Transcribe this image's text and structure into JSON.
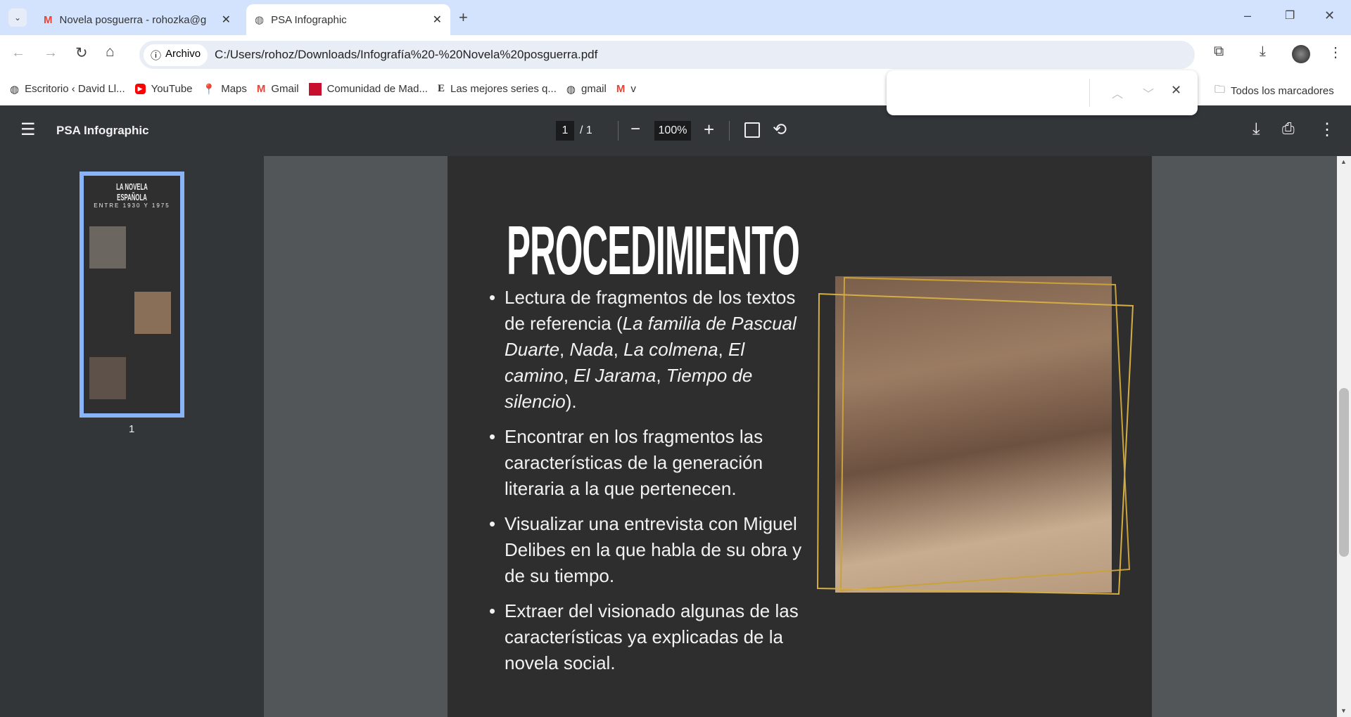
{
  "tabs": [
    {
      "label": "Novela posguerra - rohozka@g",
      "icon": "gmail-icon"
    },
    {
      "label": "PSA Infographic",
      "icon": "globe-icon"
    }
  ],
  "address": {
    "chip": "Archivo",
    "url": "C:/Users/rohoz/Downloads/Infografía%20-%20Novela%20posguerra.pdf"
  },
  "bookmarks": [
    "Escritorio ‹ David Ll...",
    "YouTube",
    "Maps",
    "Gmail",
    "Comunidad de Mad...",
    "Las mejores series q...",
    "gmail",
    "v"
  ],
  "all_bookmarks": "Todos los marcadores",
  "pdf": {
    "title": "PSA Infographic",
    "page": "1",
    "total": "/  1",
    "zoom": "100%",
    "thumb_label": "1"
  },
  "content": {
    "heading": "PROCEDIMIENTO",
    "bullet1": [
      {
        "t": "Lectura de fragmentos de los textos de referencia ("
      },
      {
        "t": "La familia de Pascual Duarte",
        "i": true
      },
      {
        "t": ", "
      },
      {
        "t": "Nada",
        "i": true
      },
      {
        "t": ", "
      },
      {
        "t": "La colmena",
        "i": true
      },
      {
        "t": ", "
      },
      {
        "t": "El camino",
        "i": true
      },
      {
        "t": ", "
      },
      {
        "t": "El Jarama",
        "i": true
      },
      {
        "t": ", "
      },
      {
        "t": "Tiempo de silencio",
        "i": true
      },
      {
        "t": ")."
      }
    ],
    "bullets": [
      "Encontrar en los fragmentos las características de la generación literaria a la que pertenecen.",
      "Visualizar una entrevista con Miguel Delibes en la que habla de su obra y de su tiempo.",
      "Extraer del visionado algunas de las características ya explicadas de la novela social."
    ]
  },
  "thumb": {
    "title": "LA NOVELA ESPAÑOLA",
    "subtitle": "ENTRE 1930 Y 1975"
  }
}
